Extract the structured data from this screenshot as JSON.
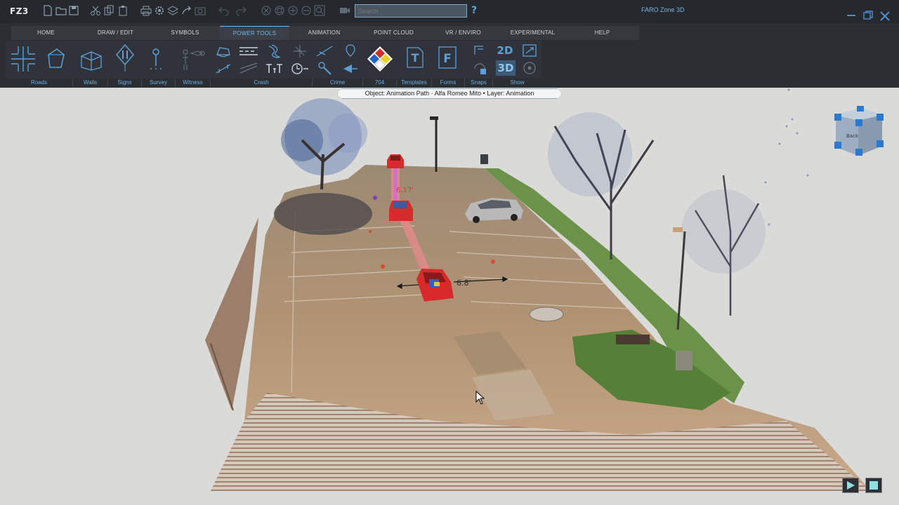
{
  "app": {
    "logo": "FZ3",
    "title": "FARO Zone 3D",
    "search_placeholder": "Search",
    "help_glyph": "?"
  },
  "window_controls": [
    "minimize-icon",
    "restore-icon",
    "close-icon"
  ],
  "quick_access_icons": [
    "new-file-icon",
    "open-folder-icon",
    "save-icon",
    "cut-icon",
    "copy-icon",
    "paste-icon",
    "print-icon",
    "settings-icon",
    "layers-icon",
    "share-icon",
    "camera-icon",
    "undo-icon",
    "redo-icon",
    "zoom-extents-icon",
    "zoom-window-icon",
    "zoom-in-icon",
    "zoom-out-icon",
    "zoom-box-icon",
    "video-icon"
  ],
  "ribbon": {
    "tabs": [
      {
        "label": "HOME",
        "active": false
      },
      {
        "label": "DRAW / EDIT",
        "active": false
      },
      {
        "label": "SYMBOLS",
        "active": false
      },
      {
        "label": "POWER TOOLS",
        "active": true
      },
      {
        "label": "ANIMATION",
        "active": false
      },
      {
        "label": "POINT CLOUD",
        "active": false
      },
      {
        "label": "VR / ENVIRO",
        "active": false
      },
      {
        "label": "EXPERIMENTAL",
        "active": false
      },
      {
        "label": "HELP",
        "active": false
      }
    ],
    "groups": [
      "Roads",
      "Walls",
      "Signs",
      "Survey",
      "Witness",
      "Crash",
      "Crime",
      "704",
      "Templates",
      "Forms",
      "Snaps",
      "Show"
    ],
    "view_2d": "2D",
    "view_3d": "3D",
    "templates_glyph": "T",
    "forms_glyph": "F"
  },
  "object_bar": "Object: Animation Path · Alfa Romeo Mito • Layer: Animation",
  "scene": {
    "measure_label_1": "6.17'",
    "measure_label_2": "6.8'",
    "navcube_label": "Back",
    "accent_color": "#6fb6ee",
    "animation_path_color": "#e08a8a"
  },
  "playback": {
    "play_icon": "play-icon",
    "stop_icon": "stop-icon"
  }
}
